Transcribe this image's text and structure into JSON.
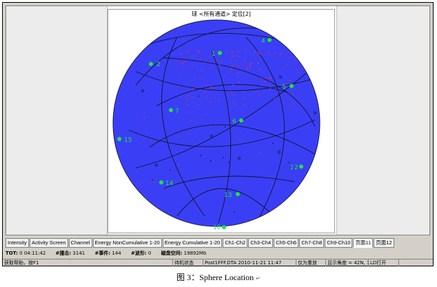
{
  "window": {
    "title": "球 <所有通道> 定位[2]"
  },
  "sphere": {
    "channels": [
      {
        "label": "1"
      },
      {
        "label": "2"
      },
      {
        "label": "4"
      },
      {
        "label": "5"
      },
      {
        "label": "6"
      },
      {
        "label": "7"
      },
      {
        "label": "15"
      },
      {
        "label": "12"
      },
      {
        "label": "14"
      },
      {
        "label": "13"
      },
      {
        "label": "10"
      }
    ],
    "colors": {
      "sphere": "#3a3ff5",
      "grid": "#111133",
      "sensor": "#1ee63a",
      "event": "#e0304a",
      "label": "#1ee63a"
    }
  },
  "tabs": [
    {
      "label": "Intensity"
    },
    {
      "label": "Activity Screen"
    },
    {
      "label": "Channel"
    },
    {
      "label": "Energy NonCumulative 1-20"
    },
    {
      "label": "Energy Cumulative 1-20"
    },
    {
      "label": "Ch1-Ch2"
    },
    {
      "label": "Ch3-Ch4"
    },
    {
      "label": "Ch5-Ch6"
    },
    {
      "label": "Ch7-Ch8"
    },
    {
      "label": "Ch9-Ch10"
    },
    {
      "label": "页面11"
    },
    {
      "label": "页面12"
    }
  ],
  "stats": {
    "tot_label": "TOT:",
    "tot_value": "0 04:11:42",
    "hits_label": "#撞击:",
    "hits_value": "3141",
    "events_label": "#事件:",
    "events_value": "144",
    "waves_label": "#波形:",
    "waves_value": "0",
    "disk_label": "磁盘空间:",
    "disk_value": "19892Mb"
  },
  "statusbar": {
    "help": "获取帮助，按F1",
    "state": "待机状态",
    "file": "Post1FFF.DTA  2010-11-21 11:47",
    "mode": "仅为重放",
    "angle": "显示角度 = 42N, 1",
    "ld": "LD打开"
  },
  "caption": {
    "text": "图 3：Sphere Location",
    "mark": "↵"
  }
}
